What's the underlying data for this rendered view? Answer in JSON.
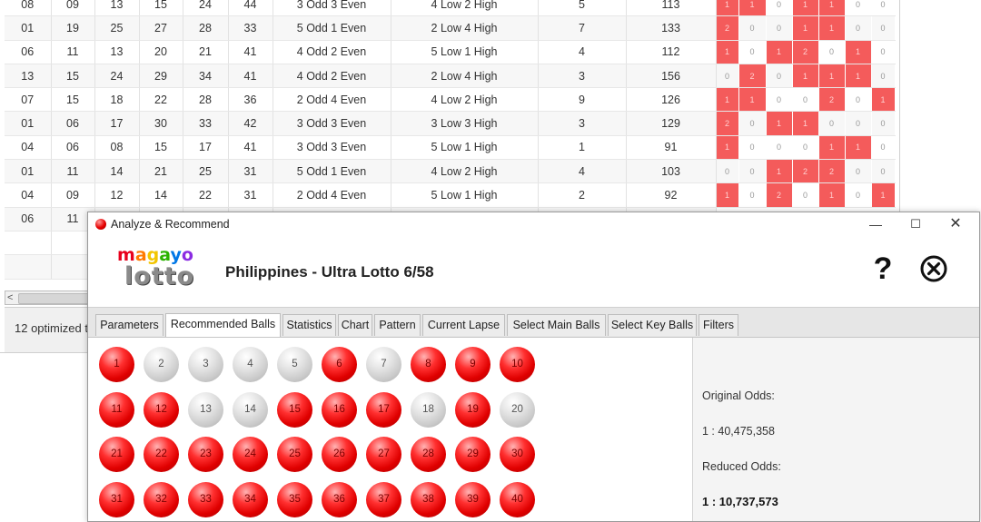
{
  "background_window": {
    "rows": [
      {
        "n": [
          "08",
          "09",
          "13",
          "15",
          "24",
          "44"
        ],
        "odd_even": "3 Odd 3 Even",
        "low_high": "4 Low 2 High",
        "c1": "5",
        "c2": "113",
        "flags": [
          1,
          1,
          0,
          1,
          1,
          0,
          0
        ]
      },
      {
        "n": [
          "01",
          "19",
          "25",
          "27",
          "28",
          "33"
        ],
        "odd_even": "5 Odd 1 Even",
        "low_high": "2 Low 4 High",
        "c1": "7",
        "c2": "133",
        "flags": [
          2,
          0,
          0,
          1,
          1,
          0,
          0
        ]
      },
      {
        "n": [
          "06",
          "11",
          "13",
          "20",
          "21",
          "41"
        ],
        "odd_even": "4 Odd 2 Even",
        "low_high": "5 Low 1 High",
        "c1": "4",
        "c2": "112",
        "flags": [
          1,
          0,
          1,
          2,
          0,
          1,
          0
        ]
      },
      {
        "n": [
          "13",
          "15",
          "24",
          "29",
          "34",
          "41"
        ],
        "odd_even": "4 Odd 2 Even",
        "low_high": "2 Low 4 High",
        "c1": "3",
        "c2": "156",
        "flags": [
          0,
          2,
          0,
          1,
          1,
          1,
          0
        ]
      },
      {
        "n": [
          "07",
          "15",
          "18",
          "22",
          "28",
          "36"
        ],
        "odd_even": "2 Odd 4 Even",
        "low_high": "4 Low 2 High",
        "c1": "9",
        "c2": "126",
        "flags": [
          1,
          1,
          0,
          0,
          2,
          0,
          1
        ]
      },
      {
        "n": [
          "01",
          "06",
          "17",
          "30",
          "33",
          "42"
        ],
        "odd_even": "3 Odd 3 Even",
        "low_high": "3 Low 3 High",
        "c1": "3",
        "c2": "129",
        "flags": [
          2,
          0,
          1,
          1,
          0,
          0,
          0
        ]
      },
      {
        "n": [
          "04",
          "06",
          "08",
          "15",
          "17",
          "41"
        ],
        "odd_even": "3 Odd 3 Even",
        "low_high": "5 Low 1 High",
        "c1": "1",
        "c2": "91",
        "flags": [
          1,
          0,
          0,
          0,
          1,
          1,
          0
        ]
      },
      {
        "n": [
          "01",
          "11",
          "14",
          "21",
          "25",
          "31"
        ],
        "odd_even": "5 Odd 1 Even",
        "low_high": "4 Low 2 High",
        "c1": "4",
        "c2": "103",
        "flags": [
          0,
          0,
          1,
          2,
          2,
          0,
          0
        ]
      },
      {
        "n": [
          "04",
          "09",
          "12",
          "14",
          "22",
          "31"
        ],
        "odd_even": "2 Odd 4 Even",
        "low_high": "5 Low 1 High",
        "c1": "2",
        "c2": "92",
        "flags": [
          1,
          0,
          2,
          0,
          1,
          0,
          1
        ]
      },
      {
        "n": [
          "06",
          "11",
          "",
          "",
          "",
          "",
          ""
        ],
        "odd_even": "",
        "low_high": "",
        "c1": "",
        "c2": "",
        "flags": []
      },
      {
        "n": [
          "",
          "",
          "",
          "",
          "",
          "",
          ""
        ],
        "odd_even": "",
        "low_high": "",
        "c1": "",
        "c2": "",
        "flags": []
      },
      {
        "n": [
          "",
          "",
          "",
          "",
          "",
          "",
          ""
        ],
        "odd_even": "",
        "low_high": "",
        "c1": "",
        "c2": "",
        "flags": []
      }
    ],
    "status_text": "12 optimized t"
  },
  "dialog": {
    "title": "Analyze & Recommend",
    "window_controls": {
      "minimize": "—",
      "maximize": "☐",
      "close": "✕"
    },
    "logo": {
      "line1": "magayo",
      "line2": "lotto"
    },
    "lottery_name": "Philippines - Ultra Lotto 6/58",
    "help_label": "?",
    "tabs": [
      "Parameters",
      "Recommended Balls",
      "Statistics",
      "Chart",
      "Pattern",
      "Current Lapse",
      "Select Main Balls",
      "Select Key Balls",
      "Filters"
    ],
    "active_tab": 1,
    "balls": [
      {
        "n": "1",
        "c": "red"
      },
      {
        "n": "2",
        "c": "gray"
      },
      {
        "n": "3",
        "c": "gray"
      },
      {
        "n": "4",
        "c": "gray"
      },
      {
        "n": "5",
        "c": "gray"
      },
      {
        "n": "6",
        "c": "red"
      },
      {
        "n": "7",
        "c": "gray"
      },
      {
        "n": "8",
        "c": "red"
      },
      {
        "n": "9",
        "c": "red"
      },
      {
        "n": "10",
        "c": "red"
      },
      {
        "n": "11",
        "c": "red"
      },
      {
        "n": "12",
        "c": "red"
      },
      {
        "n": "13",
        "c": "gray"
      },
      {
        "n": "14",
        "c": "gray"
      },
      {
        "n": "15",
        "c": "red"
      },
      {
        "n": "16",
        "c": "red"
      },
      {
        "n": "17",
        "c": "red"
      },
      {
        "n": "18",
        "c": "gray"
      },
      {
        "n": "19",
        "c": "red"
      },
      {
        "n": "20",
        "c": "gray"
      },
      {
        "n": "21",
        "c": "red"
      },
      {
        "n": "22",
        "c": "red"
      },
      {
        "n": "23",
        "c": "red"
      },
      {
        "n": "24",
        "c": "red"
      },
      {
        "n": "25",
        "c": "red"
      },
      {
        "n": "26",
        "c": "red"
      },
      {
        "n": "27",
        "c": "red"
      },
      {
        "n": "28",
        "c": "red"
      },
      {
        "n": "29",
        "c": "red"
      },
      {
        "n": "30",
        "c": "red"
      },
      {
        "n": "31",
        "c": "red"
      },
      {
        "n": "32",
        "c": "red"
      },
      {
        "n": "33",
        "c": "red"
      },
      {
        "n": "34",
        "c": "red"
      },
      {
        "n": "35",
        "c": "red"
      },
      {
        "n": "36",
        "c": "red"
      },
      {
        "n": "37",
        "c": "red"
      },
      {
        "n": "38",
        "c": "red"
      },
      {
        "n": "39",
        "c": "red"
      },
      {
        "n": "40",
        "c": "red"
      }
    ],
    "odds": {
      "original_label": "Original Odds:",
      "original_value": "1 : 40,475,358",
      "reduced_label": "Reduced Odds:",
      "reduced_value": "1 : 10,737,573"
    }
  },
  "colors": {
    "accent_red": "#e00000",
    "flag_red": "#f45b5b"
  }
}
